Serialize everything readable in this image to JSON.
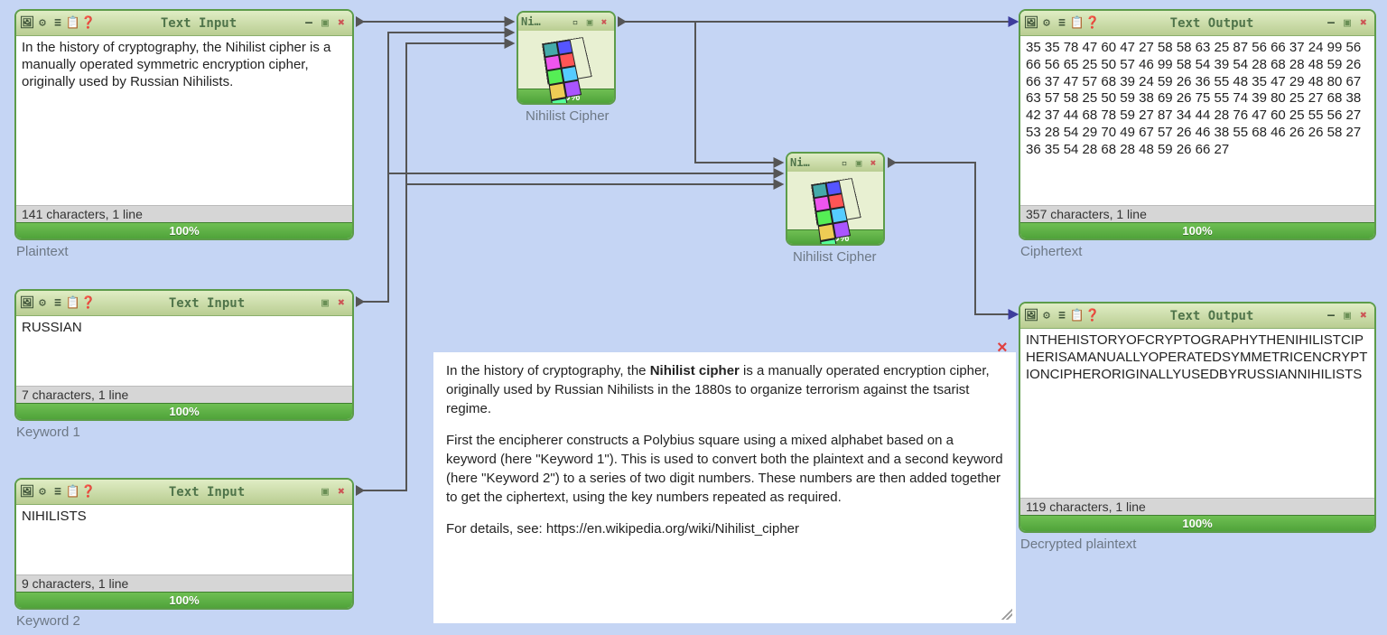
{
  "panels": {
    "plaintext": {
      "title": "Text Input",
      "content": "In the history of cryptography, the Nihilist cipher is a manually operated symmetric encryption cipher, originally used by Russian Nihilists.",
      "status": "141 characters,  1 line",
      "progress": "100%",
      "label": "Plaintext"
    },
    "keyword1": {
      "title": "Text Input",
      "content": "RUSSIAN",
      "status": "7 characters,  1 line",
      "progress": "100%",
      "label": "Keyword 1"
    },
    "keyword2": {
      "title": "Text Input",
      "content": "NIHILISTS",
      "status": "9 characters,  1 line",
      "progress": "100%",
      "label": "Keyword 2"
    },
    "ciphertext": {
      "title": "Text Output",
      "content": "35 35 78 47 60 47 27 58 58 63 25 87 56 66 37 24 99 56 66 56 65 25 50 57 46 99 58 54 39 54 28 68 28 48 59 26 66 37 47 57 68 39 24 59 26 36 55 48 35 47 29 48 80 67 63 57 58 25 50 59 38 69 26 75 55 74 39 80 25 27 68 38 42 37 44 68 78 59 27 87 34 44 28 76 47 60 25 55 56 27 53 28 54 29 70 49 67 57 26 46 38 55 68 46 26 26 58 27 36 35 54 28 68 28 48 59 26 66 27",
      "status": "357 characters,  1 line",
      "progress": "100%",
      "label": "Ciphertext"
    },
    "decrypted": {
      "title": "Text Output",
      "content": "INTHEHISTORYOFCRYPTOGRAPHYTHENIHILISTCIPHERISAMANUALLYOPERATEDSYMMETRICENCRYPTIONCIPHERORIGINALLYUSEDBYRUSSIANNIHILISTS",
      "status": "119 characters,  1 line",
      "progress": "100%",
      "label": "Decrypted plaintext"
    }
  },
  "cipher": {
    "title": "Ni…",
    "progress": "100%",
    "label": "Nihilist Cipher"
  },
  "cipher2": {
    "title": "Ni…",
    "progress": "100%",
    "label": "Nihilist Cipher"
  },
  "info": {
    "line1_pre": "In the history of cryptography, the ",
    "line1_bold": "Nihilist cipher",
    "line1_post": " is a manually operated encryption cipher, originally used by Russian Nihilists in the 1880s to organize terrorism against the tsarist regime.",
    "para2": "First the encipherer constructs a Polybius square using a mixed alphabet based on a keyword (here \"Keyword 1\"). This is used to convert both the plaintext and a second keyword (here \"Keyword 2\") to a series of two digit numbers. These numbers are then added together to get the ciphertext, using the key numbers repeated as required.",
    "para3": "For details, see: https://en.wikipedia.org/wiki/Nihilist_cipher"
  },
  "icons": {
    "presentation": "🖼",
    "gear": "⚙",
    "menu": "≡",
    "clipboard": "📋",
    "help": "❓",
    "minimize": "—",
    "maximize": "▣",
    "close": "✖",
    "info_close": "×"
  }
}
